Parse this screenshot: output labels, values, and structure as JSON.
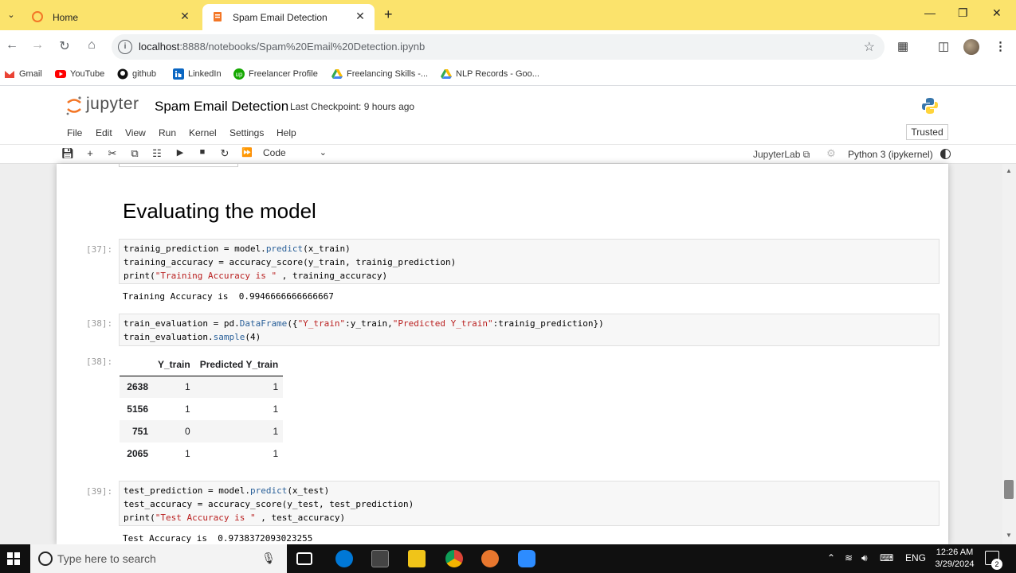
{
  "browser": {
    "tabs": [
      {
        "label": "Home"
      },
      {
        "label": "Spam Email Detection"
      }
    ],
    "url_host": "localhost",
    "url_rest": ":8888/notebooks/Spam%20Email%20Detection.ipynb",
    "bookmarks": [
      {
        "label": "Gmail"
      },
      {
        "label": "YouTube"
      },
      {
        "label": "github"
      },
      {
        "label": "LinkedIn"
      },
      {
        "label": "Freelancer Profile"
      },
      {
        "label": "Freelancing Skills -..."
      },
      {
        "label": "NLP Records - Goo..."
      }
    ]
  },
  "jupyter": {
    "logo_text": "jupyter",
    "notebook_title": "Spam Email Detection",
    "checkpoint": "Last Checkpoint: 9 hours ago",
    "menu": [
      "File",
      "Edit",
      "View",
      "Run",
      "Kernel",
      "Settings",
      "Help"
    ],
    "trusted": "Trusted",
    "cell_type": "Code",
    "jupyterlab_link": "JupyterLab",
    "kernel": "Python 3 (ipykernel)"
  },
  "notebook": {
    "heading": "Evaluating the model",
    "cell37": {
      "prompt": "[37]:",
      "output": "Training Accuracy is  0.9946666666666667"
    },
    "cell38": {
      "prompt": "[38]:",
      "out_prompt": "[38]:",
      "table": {
        "columns": [
          "Y_train",
          "Predicted Y_train"
        ],
        "rows": [
          {
            "index": "2638",
            "y": "1",
            "pred": "1"
          },
          {
            "index": "5156",
            "y": "1",
            "pred": "1"
          },
          {
            "index": "751",
            "y": "0",
            "pred": "1"
          },
          {
            "index": "2065",
            "y": "1",
            "pred": "1"
          }
        ]
      }
    },
    "cell39": {
      "prompt": "[39]:",
      "output": "Test Accuracy is  0.9738372093023255"
    }
  },
  "taskbar": {
    "search_placeholder": "Type here to search",
    "lang": "ENG",
    "time": "12:26 AM",
    "date": "3/29/2024",
    "notif_count": "2"
  }
}
